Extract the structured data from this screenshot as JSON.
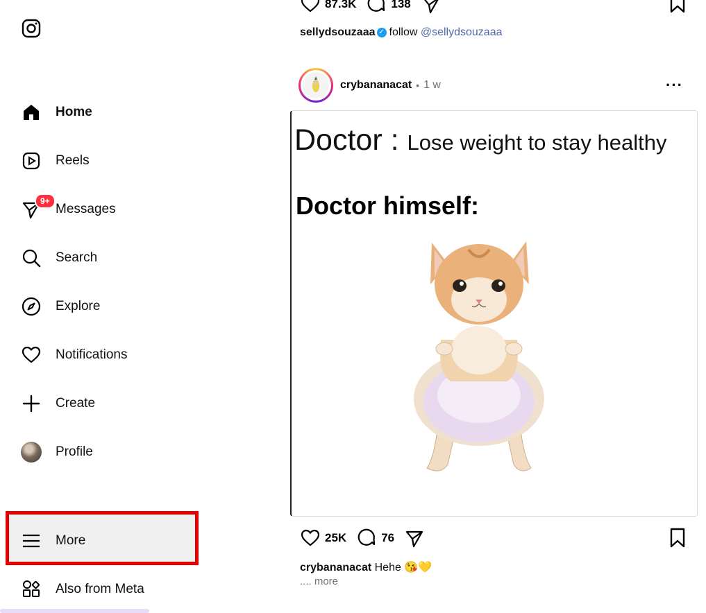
{
  "sidebar": {
    "items": [
      {
        "label": "Home",
        "icon": "home-icon",
        "active": true
      },
      {
        "label": "Reels",
        "icon": "reels-icon"
      },
      {
        "label": "Messages",
        "icon": "messages-icon",
        "badge": "9+"
      },
      {
        "label": "Search",
        "icon": "search-icon"
      },
      {
        "label": "Explore",
        "icon": "explore-icon"
      },
      {
        "label": "Notifications",
        "icon": "heart-icon"
      },
      {
        "label": "Create",
        "icon": "plus-icon"
      },
      {
        "label": "Profile",
        "icon": "avatar"
      },
      {
        "label": "More",
        "icon": "menu-icon"
      },
      {
        "label": "Also from Meta",
        "icon": "meta-apps-icon"
      }
    ]
  },
  "prev_post": {
    "likes": "87.3K",
    "comments": "138",
    "caption_user": "sellydsouzaaa",
    "caption_text": "follow",
    "caption_mention": "@sellydsouzaaa"
  },
  "post": {
    "username": "crybananacat",
    "separator": "•",
    "age": "1 w",
    "options": "···",
    "meme_line1_big": "Doctor :",
    "meme_line1_small": "Lose weight to stay healthy",
    "meme_line2": "Doctor himself:",
    "likes": "25K",
    "comments": "76",
    "caption_user": "crybananacat",
    "caption_text": "Hehe 😘💛",
    "more_label": ".... more"
  },
  "colors": {
    "badge": "#ff3040",
    "highlight_border": "#e00000",
    "mention": "#4f6aa8",
    "verified": "#1d9bf0"
  }
}
